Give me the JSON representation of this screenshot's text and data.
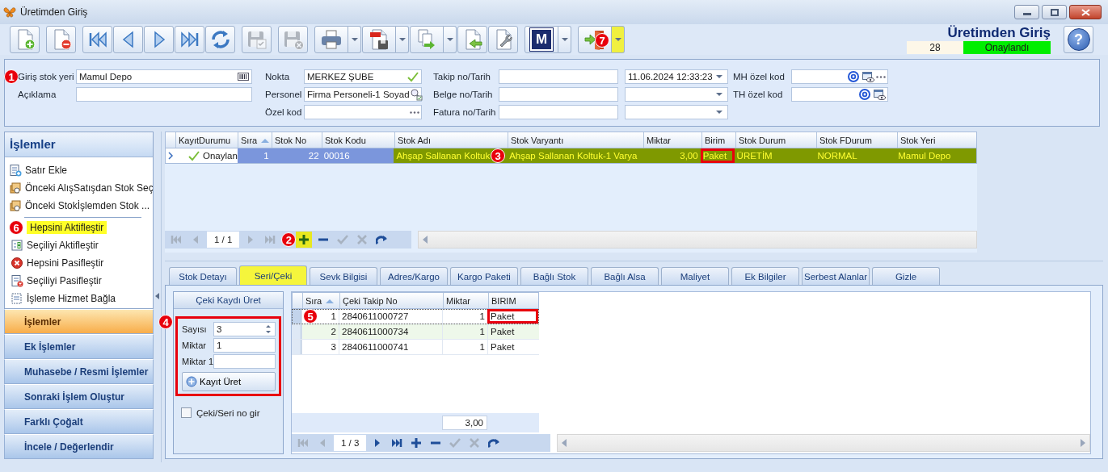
{
  "window": {
    "title": "Üretimden Giriş"
  },
  "toolbar": {
    "groups": [
      [
        {
          "kind": "new",
          "disabled": false,
          "dropdown": false
        }
      ],
      [
        {
          "kind": "delete",
          "disabled": false,
          "dropdown": false
        }
      ],
      [
        {
          "kind": "first",
          "disabled": false,
          "dropdown": false
        },
        {
          "kind": "previous",
          "disabled": false,
          "dropdown": false
        },
        {
          "kind": "next",
          "disabled": false,
          "dropdown": false
        },
        {
          "kind": "last",
          "disabled": false,
          "dropdown": false
        },
        {
          "kind": "refresh",
          "disabled": false,
          "dropdown": false
        }
      ],
      [
        {
          "kind": "save",
          "disabled": true,
          "dropdown": false
        }
      ],
      [
        {
          "kind": "discard",
          "disabled": true,
          "dropdown": false
        }
      ],
      [
        {
          "kind": "print",
          "disabled": false,
          "dropdown": true,
          "highlighted": false
        },
        {
          "kind": "pdf",
          "disabled": false,
          "dropdown": true,
          "highlighted": false
        },
        {
          "kind": "export",
          "disabled": false,
          "dropdown": true,
          "highlighted": false
        },
        {
          "kind": "import",
          "disabled": false,
          "dropdown": false
        },
        {
          "kind": "settings",
          "disabled": false,
          "dropdown": false
        }
      ],
      [
        {
          "kind": "letter",
          "label": "M",
          "disabled": false,
          "dropdown": true,
          "highlighted": false
        }
      ],
      [
        {
          "kind": "exit",
          "disabled": false,
          "dropdown": true,
          "highlighted": true,
          "callout": "7"
        }
      ]
    ],
    "heading": "Üretimden Giriş",
    "record_no": "28",
    "status": "Onaylandı",
    "help": "?"
  },
  "form": {
    "columns": [
      [
        {
          "label": "Giriş stok yeri",
          "value": "Mamul Depo",
          "kind": "barcode",
          "callout": "1"
        },
        {
          "label": "Açıklama",
          "kind": "text"
        }
      ],
      [
        {
          "label": "Nokta",
          "value": "MERKEZ ŞUBE",
          "kind": "verified"
        },
        {
          "label": "Personel",
          "value": "Firma Personeli-1 Soyad",
          "kind": "lookup"
        },
        {
          "label": "Özel kod",
          "kind": "ellipsis"
        }
      ],
      [
        {
          "label": "Takip no/Tarih",
          "kind": "text"
        },
        {
          "label": "Belge no/Tarih",
          "kind": "text"
        },
        {
          "label": "Fatura no/Tarih",
          "kind": "text"
        }
      ],
      [
        {
          "value": "11.06.2024 12:33:23",
          "kind": "combo"
        },
        {
          "kind": "combo"
        },
        {
          "kind": "combo"
        }
      ],
      [
        {
          "label": "MH özel kod",
          "kind": "code-more"
        },
        {
          "label": "TH özel kod",
          "kind": "code"
        }
      ]
    ]
  },
  "sidebar": {
    "title": "İşlemler",
    "groups": [
      [
        {
          "label": "Satır Ekle",
          "kind": "add-row",
          "highlighted": false
        },
        {
          "label": "Önceki AlışSatışdan Stok Seç",
          "kind": "pick",
          "highlighted": false
        },
        {
          "label": "Önceki Stokİşlemden Stok ...",
          "kind": "pick",
          "highlighted": false
        }
      ],
      [
        {
          "label": "Hepsini Aktifleştir",
          "highlighted": true,
          "callout": "6"
        },
        {
          "label": "Seçiliyi Aktifleştir",
          "kind": "activate",
          "highlighted": false
        },
        {
          "label": "Hepsini Pasifleştir",
          "kind": "deactivate-all",
          "highlighted": false
        },
        {
          "label": "Seçiliyi Pasifleştir",
          "kind": "deactivate",
          "highlighted": false
        },
        {
          "label": "İşleme Hizmet Bağla",
          "kind": "link",
          "highlighted": false
        }
      ]
    ],
    "sections": [
      {
        "label": "İşlemler",
        "selected": true
      },
      {
        "label": "Ek İşlemler",
        "selected": false
      },
      {
        "label": "Muhasebe / Resmi İşlemler",
        "selected": false
      },
      {
        "label": "Sonraki İşlem Oluştur",
        "selected": false
      },
      {
        "label": "Farklı Çoğalt",
        "selected": false
      },
      {
        "label": "İncele / Değerlendir",
        "selected": false
      }
    ]
  },
  "grid": {
    "columns": [
      {
        "label": "KayıtDurumu",
        "sorted": false,
        "numeric": false
      },
      {
        "label": "Sıra",
        "sorted": true,
        "numeric": true
      },
      {
        "label": "Stok No",
        "sorted": false,
        "numeric": true
      },
      {
        "label": "Stok Kodu",
        "sorted": false,
        "numeric": false
      },
      {
        "label": "Stok Adı",
        "sorted": false,
        "numeric": false
      },
      {
        "label": "Stok Varyantı",
        "sorted": false,
        "numeric": false
      },
      {
        "label": "Miktar",
        "sorted": false,
        "numeric": true
      },
      {
        "label": "Birim",
        "sorted": false,
        "numeric": false
      },
      {
        "label": "Stok Durum",
        "sorted": false,
        "numeric": false
      },
      {
        "label": "Stok FDurum",
        "sorted": false,
        "numeric": false
      },
      {
        "label": "Stok Yeri",
        "sorted": false,
        "numeric": false
      }
    ],
    "rows": [
      {
        "selected": true,
        "color": "#7f9900",
        "cells": [
          {
            "text": "Onaylan",
            "kind": "status",
            "selected": false,
            "outlined": false
          },
          {
            "text": "1",
            "selected": true,
            "outlined": false
          },
          {
            "text": "22",
            "selected": true,
            "outlined": false
          },
          {
            "text": "00016",
            "selected": true,
            "outlined": false
          },
          {
            "text": "Ahşap Sallanan Koltuk",
            "selected": false,
            "outlined": false,
            "callout": "3"
          },
          {
            "text": "Ahşap Sallanan Koltuk-1 Varya",
            "selected": false,
            "outlined": false
          },
          {
            "text": "3,00",
            "selected": false,
            "outlined": false
          },
          {
            "text": "Paket",
            "selected": false,
            "outlined": true
          },
          {
            "text": "ÜRETİM",
            "selected": false,
            "outlined": false
          },
          {
            "text": "NORMAL",
            "selected": false,
            "outlined": false
          },
          {
            "text": "Mamul Depo",
            "selected": false,
            "outlined": false
          }
        ]
      }
    ],
    "navigator": {
      "page": "1 / 1",
      "buttons": [
        {
          "kind": "first",
          "disabled": true,
          "highlighted": false
        },
        {
          "kind": "previous",
          "disabled": true,
          "highlighted": false
        },
        {
          "kind": "next",
          "disabled": true,
          "highlighted": false
        },
        {
          "kind": "last",
          "disabled": true,
          "highlighted": false
        },
        {
          "kind": "add",
          "disabled": false,
          "highlighted": true,
          "callout": "2"
        },
        {
          "kind": "remove",
          "disabled": false,
          "highlighted": false
        },
        {
          "kind": "confirm",
          "disabled": true,
          "highlighted": false
        },
        {
          "kind": "cancel",
          "disabled": true,
          "highlighted": false
        },
        {
          "kind": "refresh",
          "disabled": false,
          "highlighted": false
        }
      ]
    }
  },
  "tabs": [
    {
      "label": "Stok Detayı",
      "selected": false,
      "highlighted": false
    },
    {
      "label": "Seri/Çeki",
      "selected": true,
      "highlighted": true
    },
    {
      "label": "Sevk Bilgisi",
      "selected": false,
      "highlighted": false
    },
    {
      "label": "Adres/Kargo",
      "selected": false,
      "highlighted": false
    },
    {
      "label": "Kargo Paketi",
      "selected": false,
      "highlighted": false
    },
    {
      "label": "Bağlı Stok",
      "selected": false,
      "highlighted": false
    },
    {
      "label": "Bağlı Alsa",
      "selected": false,
      "highlighted": false
    },
    {
      "label": "Maliyet",
      "selected": false,
      "highlighted": false
    },
    {
      "label": "Ek Bilgiler",
      "selected": false,
      "highlighted": false
    },
    {
      "label": "Serbest Alanlar",
      "selected": false,
      "highlighted": false
    },
    {
      "label": "Gizle",
      "selected": false,
      "highlighted": false
    }
  ],
  "ceki_panel": {
    "title": "Çeki Kaydı Üret",
    "callout": "4",
    "outlined": true,
    "fields": [
      {
        "label": "Sayısı",
        "value": "3",
        "kind": "spin"
      },
      {
        "label": "Miktar",
        "value": "1",
        "kind": "text"
      },
      {
        "label": "Miktar 1",
        "kind": "text"
      }
    ],
    "button": "Kayıt Üret",
    "checkbox": {
      "label": "Çeki/Seri no gir",
      "checked": false
    }
  },
  "ceki_grid": {
    "columns": [
      {
        "label": "Sıra",
        "sorted": true,
        "numeric": true
      },
      {
        "label": "Çeki Takip No",
        "sorted": false,
        "numeric": false
      },
      {
        "label": "Miktar",
        "sorted": false,
        "numeric": true
      },
      {
        "label": "BIRIM",
        "sorted": false,
        "numeric": false
      }
    ],
    "rows": [
      {
        "selected": true,
        "callout": "5",
        "cells": [
          {
            "text": "1",
            "outlined": false
          },
          {
            "text": "2840611000727",
            "outlined": false
          },
          {
            "text": "1",
            "outlined": false
          },
          {
            "text": "Paket",
            "outlined": true
          }
        ]
      },
      {
        "selected": false,
        "cells": [
          {
            "text": "2",
            "outlined": false
          },
          {
            "text": "2840611000734",
            "outlined": false
          },
          {
            "text": "1",
            "outlined": false
          },
          {
            "text": "Paket",
            "outlined": false
          }
        ]
      },
      {
        "selected": false,
        "cells": [
          {
            "text": "3",
            "outlined": false
          },
          {
            "text": "2840611000741",
            "outlined": false
          },
          {
            "text": "1",
            "outlined": false
          },
          {
            "text": "Paket",
            "outlined": false
          }
        ]
      }
    ],
    "total": "3,00",
    "navigator": {
      "page": "1 / 3",
      "buttons": [
        {
          "kind": "first",
          "disabled": true,
          "highlighted": false
        },
        {
          "kind": "previous",
          "disabled": true,
          "highlighted": false
        },
        {
          "kind": "next",
          "disabled": false,
          "highlighted": false
        },
        {
          "kind": "last",
          "disabled": false,
          "highlighted": false
        },
        {
          "kind": "add",
          "disabled": false,
          "highlighted": false
        },
        {
          "kind": "remove",
          "disabled": false,
          "highlighted": false
        },
        {
          "kind": "confirm",
          "disabled": true,
          "highlighted": false
        },
        {
          "kind": "cancel",
          "disabled": true,
          "highlighted": false
        },
        {
          "kind": "refresh",
          "disabled": false,
          "highlighted": false
        }
      ]
    }
  }
}
